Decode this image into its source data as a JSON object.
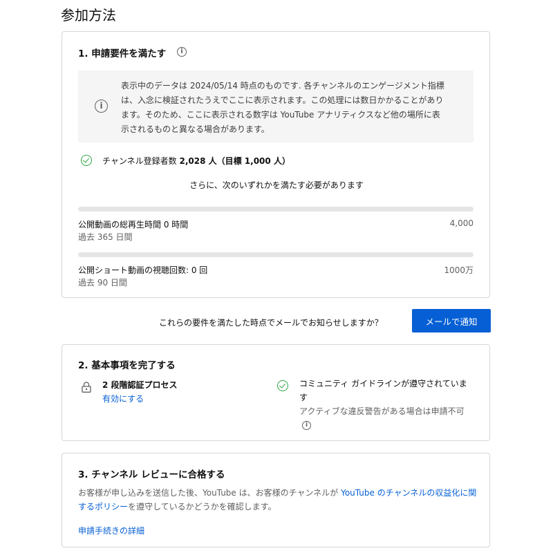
{
  "page_title": "参加方法",
  "section1": {
    "title": "1. 申請要件を満たす",
    "notice": "表示中のデータは 2024/05/14 時点のものです. 各チャンネルのエンゲージメント指標は、入念に検証されたうえでここに表示されます。この処理には数日かかることがあります。そのため、ここに表示される数字は YouTube アナリティクスなど他の場所に表示されるものと異なる場合があります。",
    "subscribers": {
      "label": "チャンネル登録者数",
      "count": "2,028 人",
      "goal": "（目標 1,000 人）",
      "met": true
    },
    "additional_requirement": "さらに、次のいずれかを満たす必要があります",
    "metrics": [
      {
        "label": "公開動画の総再生時間 0 時間",
        "period": "過去 365 日間",
        "target": "4,000",
        "progress": 0
      },
      {
        "label": "公開ショート動画の視聴回数: 0 回",
        "period": "過去 90 日間",
        "target": "1000万",
        "progress": 0
      }
    ]
  },
  "notify": {
    "question": "これらの要件を満たした時点でメールでお知らせしますか？",
    "button_label": "メールで通知"
  },
  "section2": {
    "title": "2. 基本事項を完了する",
    "two_step": {
      "title": "2 段階認証プロセス",
      "link": "有効にする"
    },
    "community": {
      "title": "コミュニティ ガイドラインが遵守されています",
      "note": "アクティブな違反警告がある場合は申請不可"
    }
  },
  "section3": {
    "title": "3. チャンネル レビューに合格する",
    "text_before": "お客様が申し込みを送信した後、YouTube は、お客様のチャンネルが ",
    "policy_link": "YouTube のチャンネルの収益化に関するポリシー",
    "text_after": "を遵守しているかどうかを確認します。",
    "details_link": "申請手続きの詳細"
  },
  "colors": {
    "accent": "#065fd4",
    "success": "#2ba640",
    "muted": "#606060",
    "border": "#d6d6d6"
  },
  "icons": [
    "info-icon",
    "check-circle-icon",
    "lock-icon"
  ]
}
